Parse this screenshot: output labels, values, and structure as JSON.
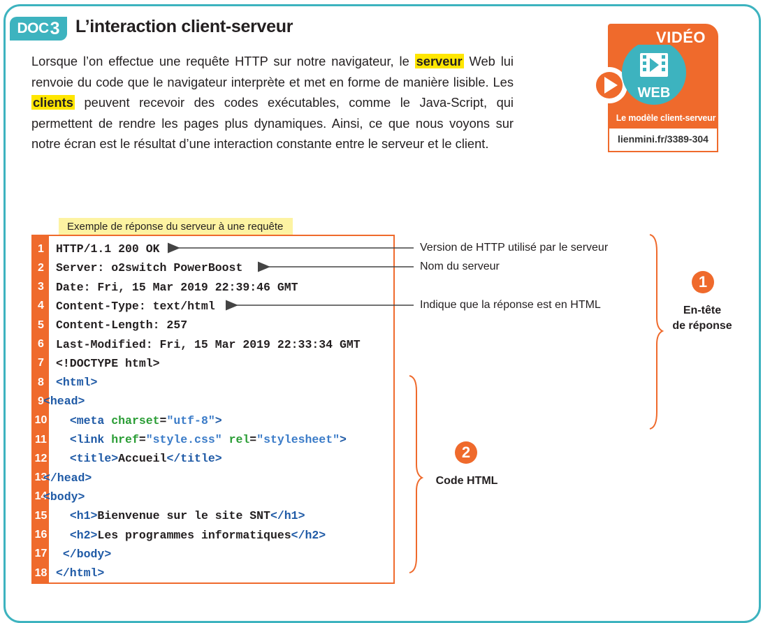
{
  "doc": {
    "badge_word": "DOC",
    "badge_num": "3",
    "title": "L’interaction client-serveur"
  },
  "intro": {
    "t1": "Lorsque l’on effectue une requête HTTP sur notre navigateur, le ",
    "h1": "serveur",
    "t2": " Web lui renvoie du code que le navigateur interprète et met en forme de manière lisible. Les ",
    "h2": "clients",
    "t3": " peuvent recevoir des codes exécutables, comme le Java-Script, qui permettent de rendre les pages plus dynamiques. Ainsi, ce que nous voyons sur notre écran est le résultat d’une interaction constante entre le serveur et le client."
  },
  "video": {
    "label": "VIDÉO",
    "badge": "WEB",
    "subtitle": "Le modèle client-serveur",
    "link": "lienmini.fr/3389-304",
    "accent": "#ef6a2c",
    "badge_color": "#3db3bf"
  },
  "caption": "Exemple de réponse du serveur à une requête",
  "code_lines": [
    {
      "n": "1",
      "pre": "",
      "tag": "",
      "rest": "HTTP/1.1 200 OK"
    },
    {
      "n": "2",
      "rest": "Server: o2switch PowerBoost"
    },
    {
      "n": "3",
      "rest": "Date: Fri, 15 Mar 2019 22:39:46 GMT"
    },
    {
      "n": "4",
      "rest": "Content-Type: text/html"
    },
    {
      "n": "5",
      "rest": "Content-Length: 257"
    },
    {
      "n": "6",
      "rest": "Last-Modified: Fri, 15 Mar 2019 22:33:34 GMT"
    },
    {
      "n": "7",
      "rest": "<!DOCTYPE html>"
    },
    {
      "n": "8",
      "tag1": "<html>"
    },
    {
      "n": "9",
      "tag1": "<head>"
    },
    {
      "n": "10",
      "tag1": "<meta ",
      "attr1": "charset",
      "eq1": "=",
      "str1": "\"utf-8\"",
      "end": ">"
    },
    {
      "n": "11",
      "tag1": "<link ",
      "attr1": "href",
      "eq1": "=",
      "str1": "\"style.css\"",
      "attr2": " rel",
      "eq2": "=",
      "str2": "\"stylesheet\"",
      "end": ">"
    },
    {
      "n": "12",
      "tag1": "<title>",
      "text": "Accueil",
      "tag2": "</title>"
    },
    {
      "n": "13",
      "tag1": "</head>"
    },
    {
      "n": "14",
      "tag1": "<body>"
    },
    {
      "n": "15",
      "tag1": "<h1>",
      "text": "Bienvenue sur le site SNT",
      "tag2": "</h1>"
    },
    {
      "n": "16",
      "tag1": "<h2>",
      "text": "Les programmes informatiques",
      "tag2": "</h2>"
    },
    {
      "n": "17",
      "tag1": "</body>"
    },
    {
      "n": "18",
      "tag1": "</html>"
    }
  ],
  "annotations": {
    "a1": "Version de HTTP utilisé par le serveur",
    "a2": "Nom du serveur",
    "a3": "Indique que la réponse est en HTML"
  },
  "sections": {
    "s1_num": "1",
    "s1_line1": "En-tête",
    "s1_line2": "de réponse",
    "s2_num": "2",
    "s2_label": "Code HTML"
  }
}
